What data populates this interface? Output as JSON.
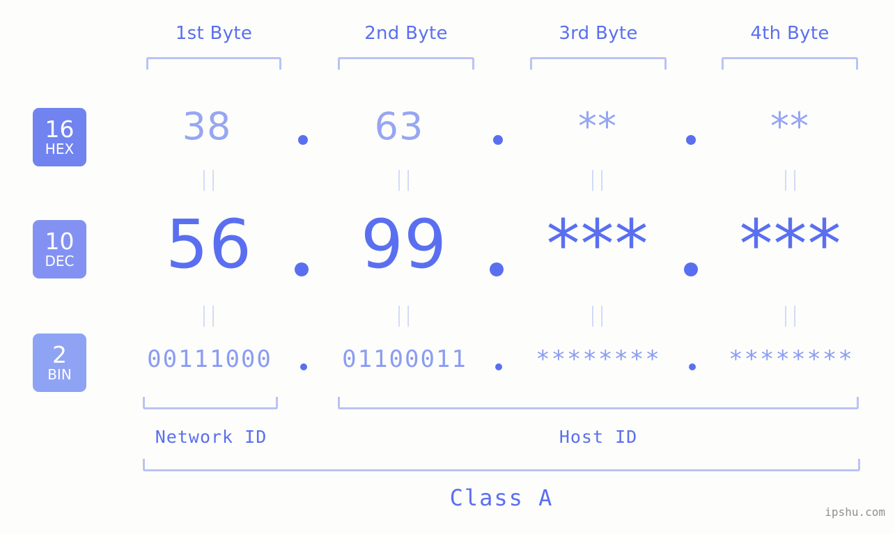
{
  "meta": {
    "background_color": "#fdfefb",
    "accent_strong": "#5a6ff0",
    "accent_light": "#97a6f2",
    "accent_pale": "#b9c3f7",
    "watermark": "ipshu.com"
  },
  "byte_headers": [
    {
      "label": "1st Byte"
    },
    {
      "label": "2nd Byte"
    },
    {
      "label": "3rd Byte"
    },
    {
      "label": "4th Byte"
    }
  ],
  "radix_badges": [
    {
      "number": "16",
      "system": "HEX",
      "color": "#7083ef"
    },
    {
      "number": "10",
      "system": "DEC",
      "color": "#8392f2"
    },
    {
      "number": "2",
      "system": "BIN",
      "color": "#8fa3f5"
    }
  ],
  "rows": {
    "hex": {
      "values": [
        "38",
        "63",
        "**",
        "**"
      ],
      "separator": "."
    },
    "dec": {
      "values": [
        "56",
        "99",
        "***",
        "***"
      ],
      "separator": "."
    },
    "bin": {
      "values": [
        "00111000",
        "01100011",
        "********",
        "********"
      ],
      "separator": "."
    }
  },
  "equals_marker": "||",
  "sections": {
    "network_id": "Network ID",
    "host_id": "Host ID",
    "class": "Class A"
  }
}
